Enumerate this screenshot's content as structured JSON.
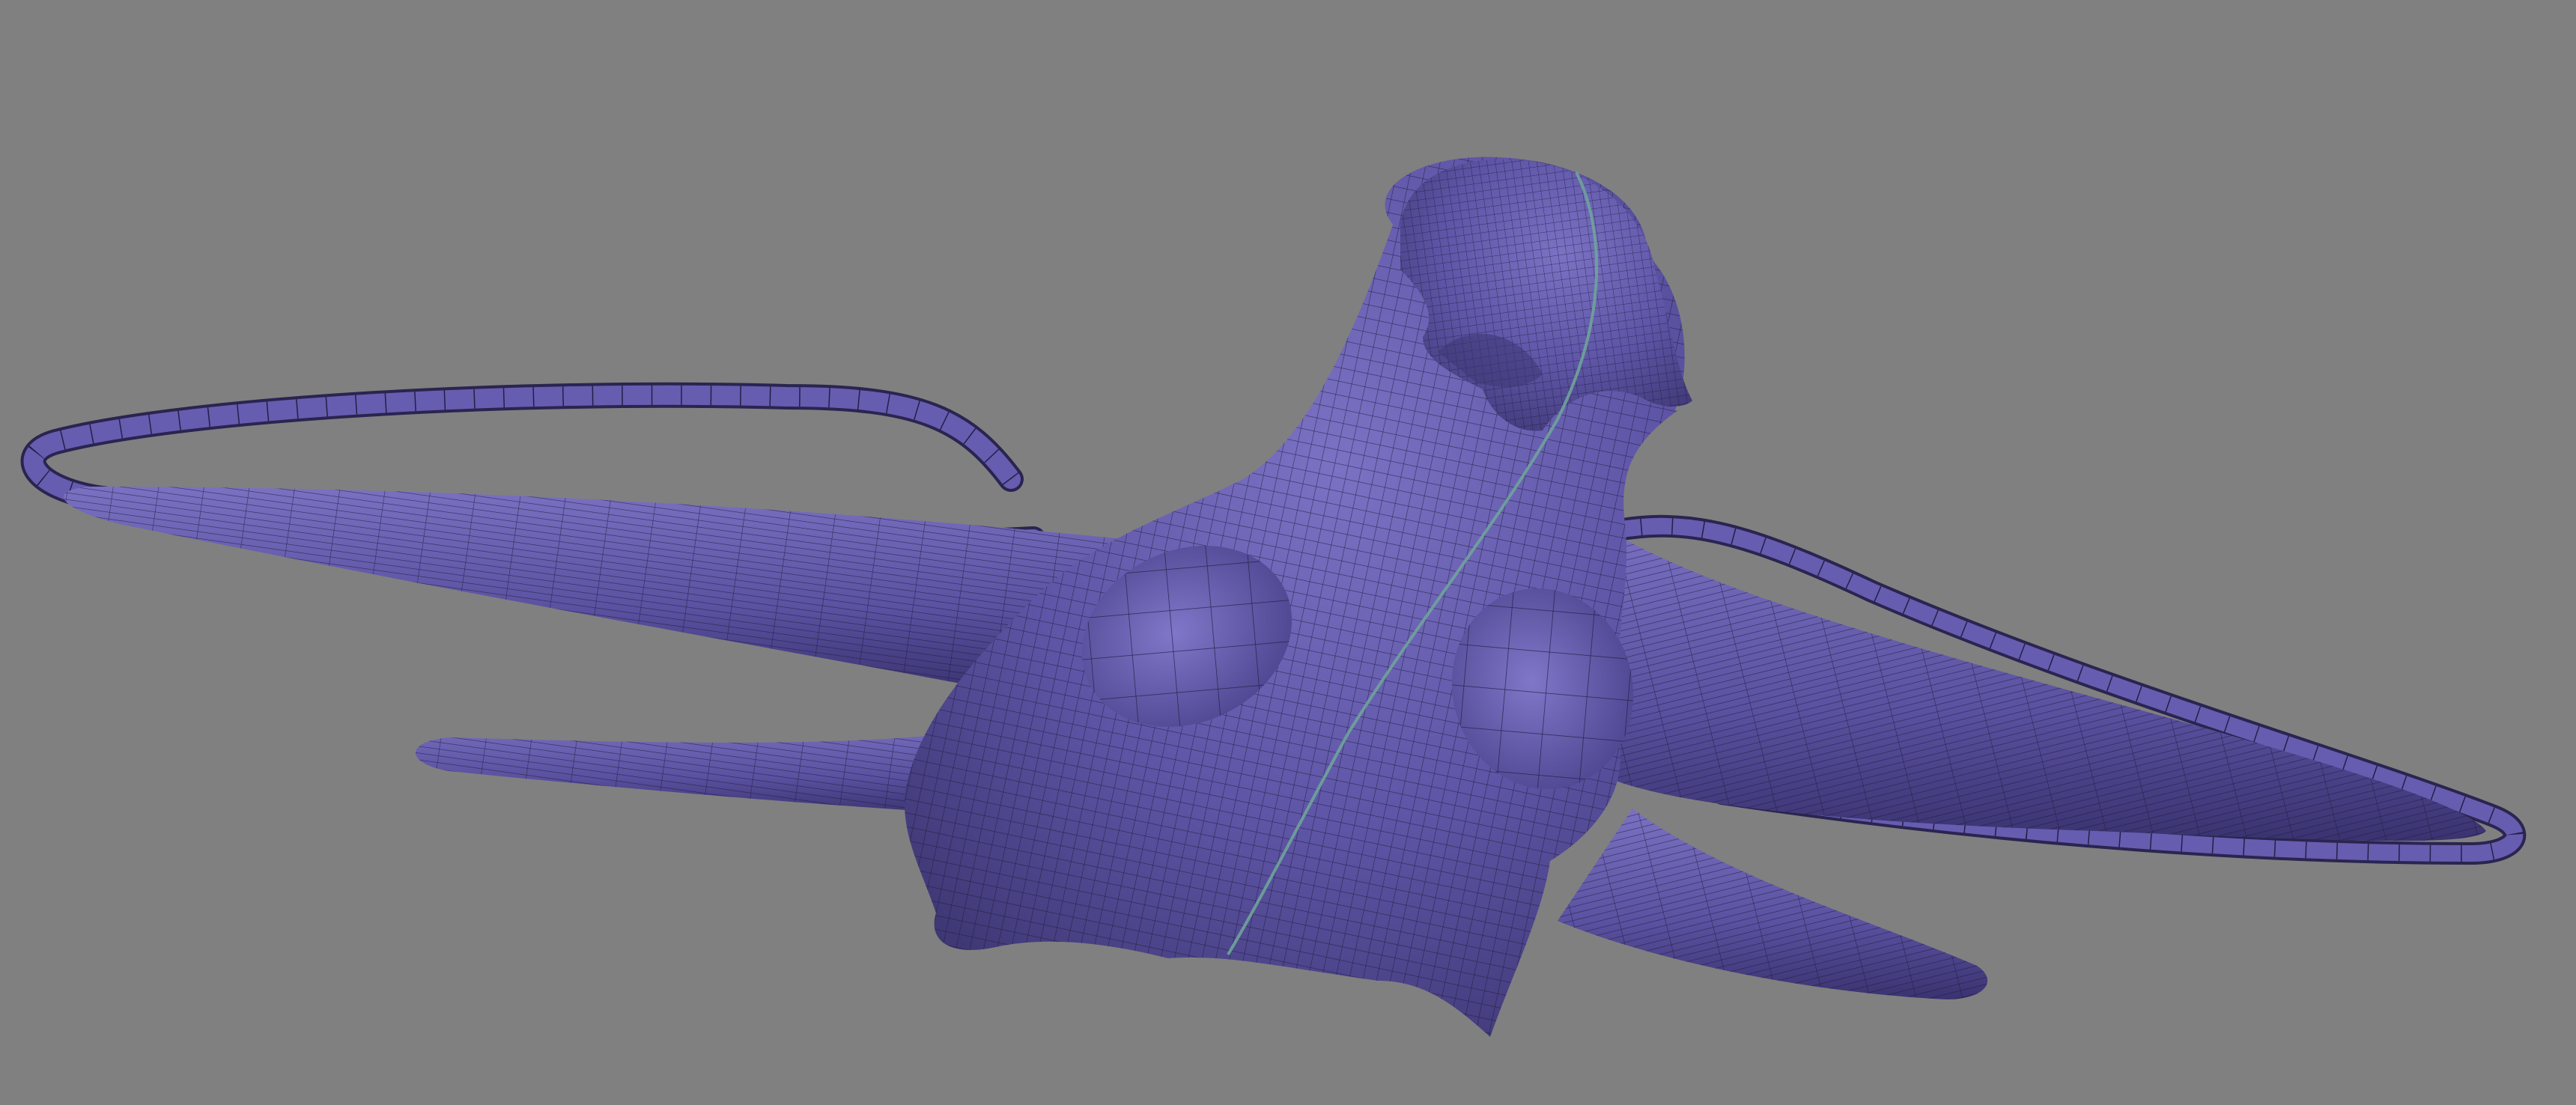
{
  "viewport": {
    "background_color": "#808080",
    "shading": "wireframe-on-shaded",
    "mesh": {
      "name": "",
      "surface_color": "#5e55a6",
      "highlight_color": "#7b72c4",
      "shadow_color": "#3d3672",
      "wire_color": "#1c1838",
      "seam_color": "#6fa39a",
      "description_icon": "sculpted-organic-mesh"
    }
  }
}
